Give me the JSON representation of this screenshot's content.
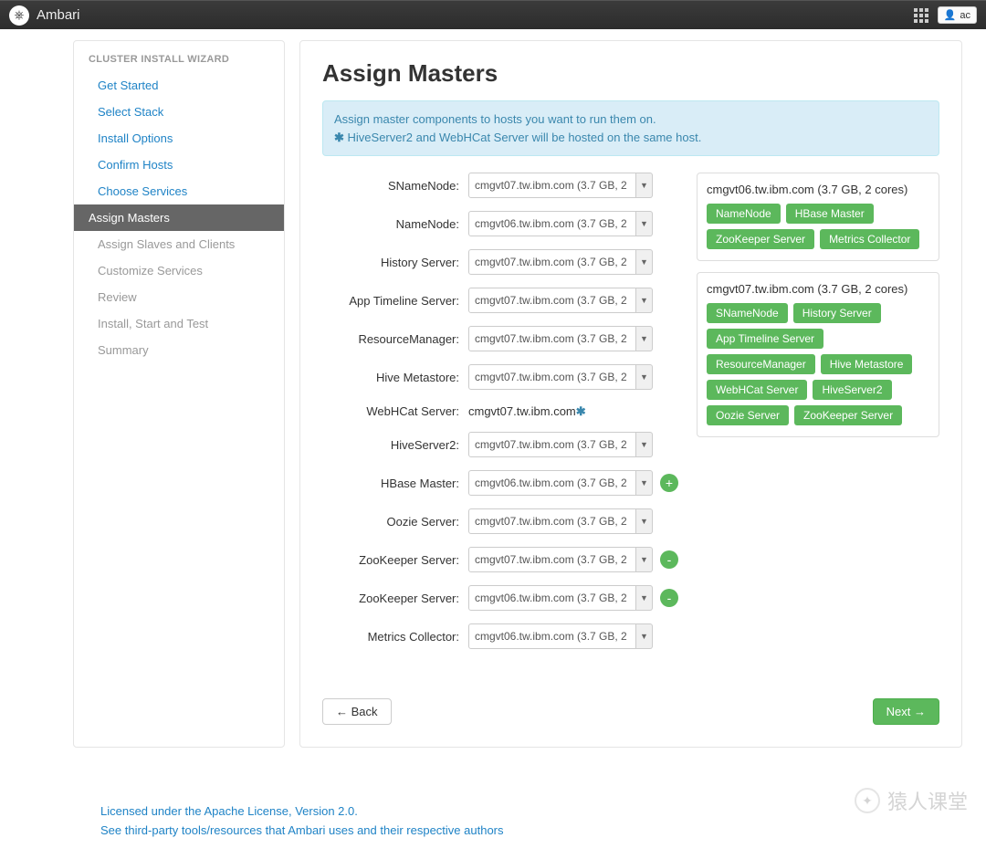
{
  "brand": "Ambari",
  "user_button": "ac",
  "sidebar": {
    "title": "CLUSTER INSTALL WIZARD",
    "items": [
      {
        "label": "Get Started",
        "state": "done"
      },
      {
        "label": "Select Stack",
        "state": "done"
      },
      {
        "label": "Install Options",
        "state": "done"
      },
      {
        "label": "Confirm Hosts",
        "state": "done"
      },
      {
        "label": "Choose Services",
        "state": "done"
      },
      {
        "label": "Assign Masters",
        "state": "active"
      },
      {
        "label": "Assign Slaves and Clients",
        "state": "pending"
      },
      {
        "label": "Customize Services",
        "state": "pending"
      },
      {
        "label": "Review",
        "state": "pending"
      },
      {
        "label": "Install, Start and Test",
        "state": "pending"
      },
      {
        "label": "Summary",
        "state": "pending"
      }
    ]
  },
  "page": {
    "title": "Assign Masters",
    "alert_line1": "Assign master components to hosts you want to run them on.",
    "alert_line2": "HiveServer2 and WebHCat Server will be hosted on the same host."
  },
  "host_option_07": "cmgvt07.tw.ibm.com (3.7 GB, 2",
  "host_option_06": "cmgvt06.tw.ibm.com (3.7 GB, 2",
  "assignments": [
    {
      "label": "SNameNode:",
      "value_key": "host_option_07",
      "extra": null
    },
    {
      "label": "NameNode:",
      "value_key": "host_option_06",
      "extra": null
    },
    {
      "label": "History Server:",
      "value_key": "host_option_07",
      "extra": null
    },
    {
      "label": "App Timeline Server:",
      "value_key": "host_option_07",
      "extra": null
    },
    {
      "label": "ResourceManager:",
      "value_key": "host_option_07",
      "extra": null
    },
    {
      "label": "Hive Metastore:",
      "value_key": "host_option_07",
      "extra": null
    },
    {
      "label": "WebHCat Server:",
      "plain": "cmgvt07.tw.ibm.com",
      "star": true
    },
    {
      "label": "HiveServer2:",
      "value_key": "host_option_07",
      "extra": null
    },
    {
      "label": "HBase Master:",
      "value_key": "host_option_06",
      "extra": "add"
    },
    {
      "label": "Oozie Server:",
      "value_key": "host_option_07",
      "extra": null
    },
    {
      "label": "ZooKeeper Server:",
      "value_key": "host_option_07",
      "extra": "remove"
    },
    {
      "label": "ZooKeeper Server:",
      "value_key": "host_option_06",
      "extra": "remove"
    },
    {
      "label": "Metrics Collector:",
      "value_key": "host_option_06",
      "extra": null
    }
  ],
  "host_panels": [
    {
      "title": "cmgvt06.tw.ibm.com (3.7 GB, 2 cores)",
      "badges": [
        "NameNode",
        "HBase Master",
        "ZooKeeper Server",
        "Metrics Collector"
      ]
    },
    {
      "title": "cmgvt07.tw.ibm.com (3.7 GB, 2 cores)",
      "badges": [
        "SNameNode",
        "History Server",
        "App Timeline Server",
        "ResourceManager",
        "Hive Metastore",
        "WebHCat Server",
        "HiveServer2",
        "Oozie Server",
        "ZooKeeper Server"
      ]
    }
  ],
  "buttons": {
    "back": "← Back",
    "next": "Next →"
  },
  "footer": {
    "line1": "Licensed under the Apache License, Version 2.0.",
    "line2": "See third-party tools/resources that Ambari uses and their respective authors"
  },
  "watermark": "猿人课堂"
}
